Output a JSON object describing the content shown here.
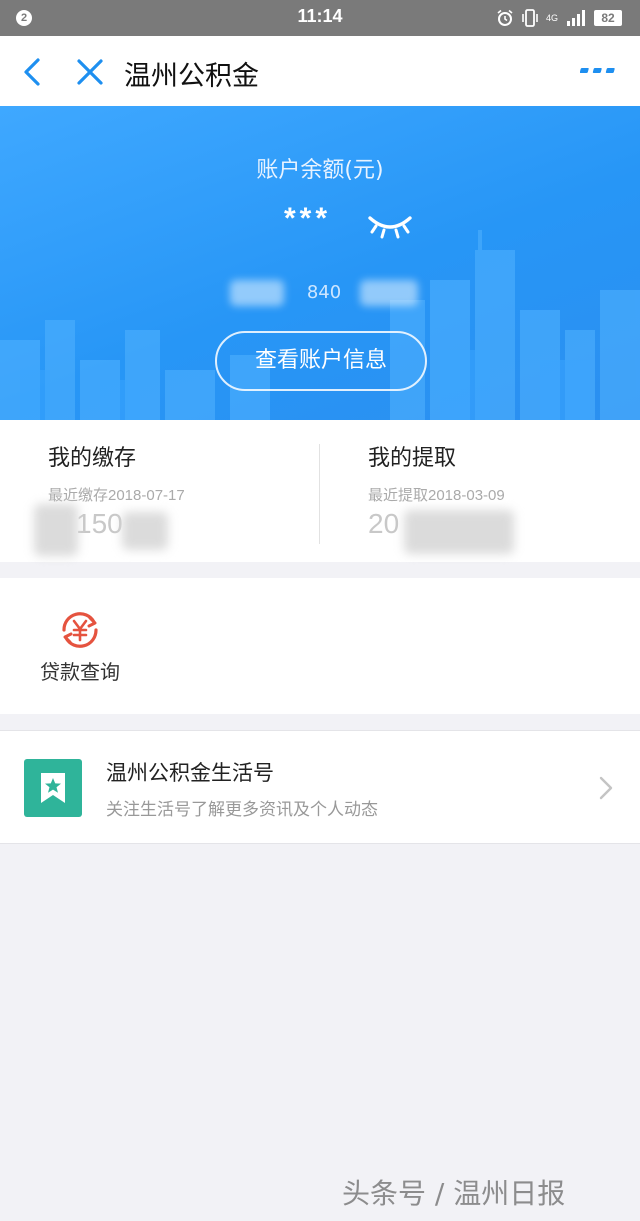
{
  "status_bar": {
    "notification_count": "2",
    "time": "11:14",
    "network": "4G",
    "battery": "82",
    "icons": [
      "alarm-icon",
      "vibrate-icon",
      "signal-icon",
      "battery-icon"
    ]
  },
  "nav": {
    "title": "温州公积金",
    "back_icon": "chevron-left-icon",
    "close_icon": "close-icon",
    "more_icon": "more-icon",
    "accent_color": "#1e8ff0"
  },
  "hero": {
    "balance_label": "账户余额(元)",
    "balance_masked": "***",
    "eye_icon": "eye-closed-icon",
    "account_partial": "840",
    "account_button": "查看账户信息",
    "background_color": "#2796f6"
  },
  "summary": {
    "deposit": {
      "title": "我的缴存",
      "latest": "最近缴存2018-07-17",
      "amount_partial": "150"
    },
    "withdraw": {
      "title": "我的提取",
      "latest": "最近提取2018-03-09",
      "amount_partial": "20"
    }
  },
  "services": {
    "loan": {
      "label": "贷款查询",
      "icon": "yuan-refresh-icon",
      "icon_color": "#e5533f"
    }
  },
  "life_account": {
    "name": "温州公积金生活号",
    "description": "关注生活号了解更多资讯及个人动态",
    "logo_icon": "bookmark-star-icon",
    "logo_color": "#2fb49a",
    "arrow_icon": "chevron-right-icon"
  },
  "watermark": "头条号 / 温州日报"
}
